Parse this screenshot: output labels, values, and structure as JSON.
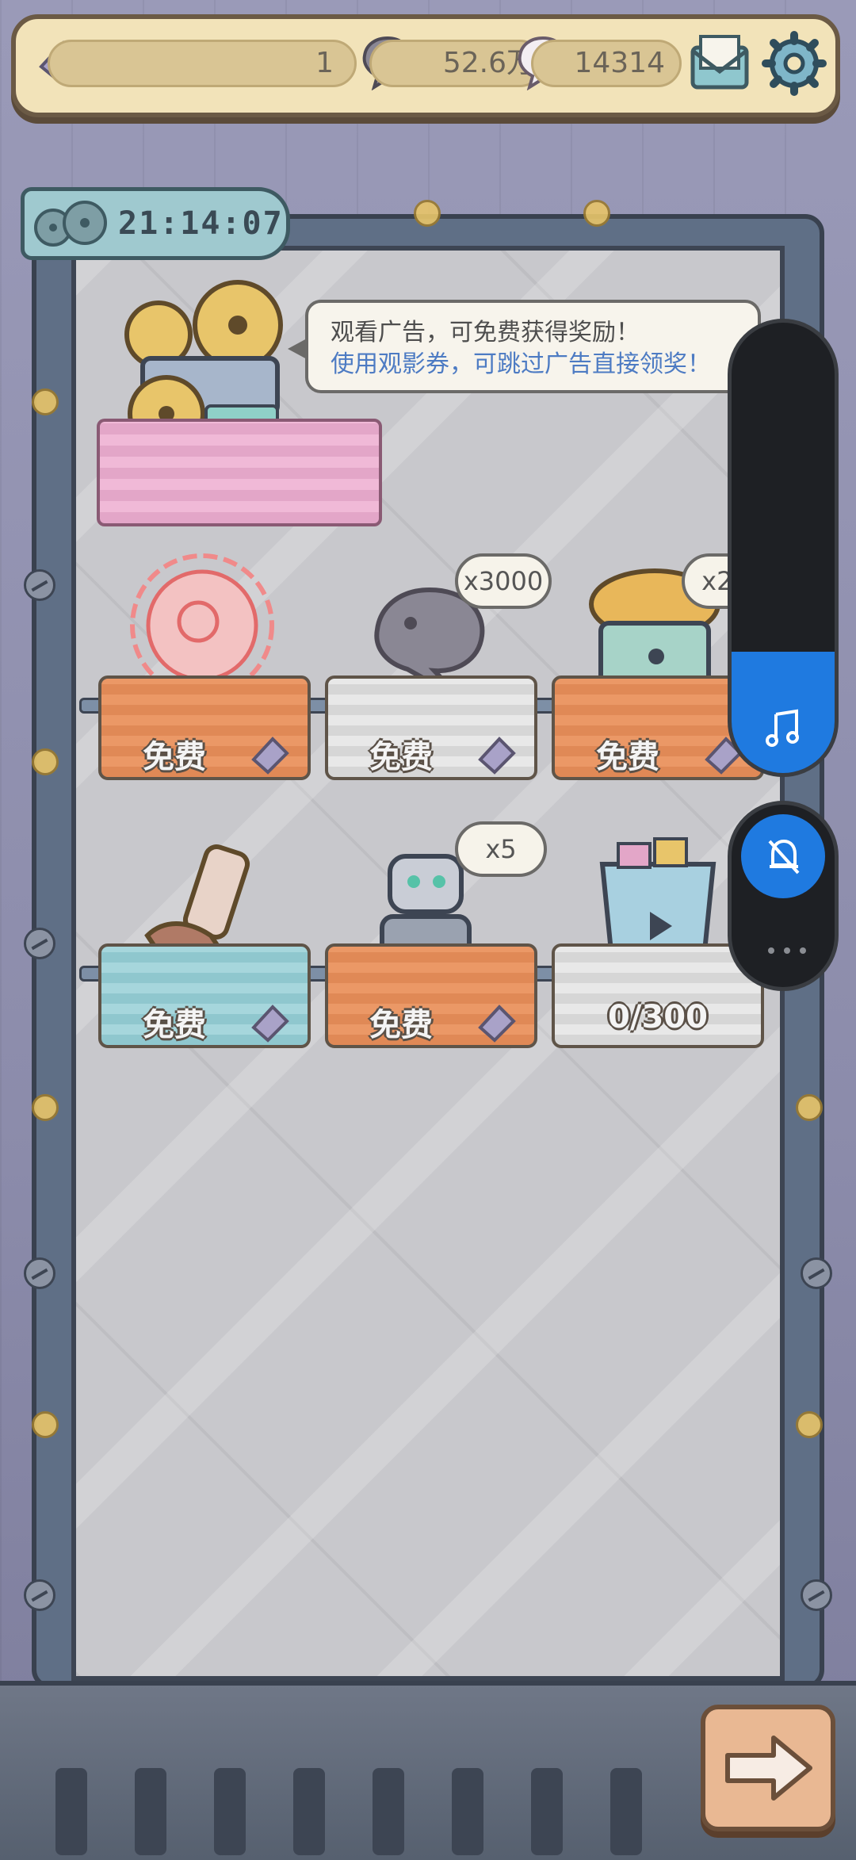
{
  "hud": {
    "tickets": "1",
    "coins": "52.6万",
    "gems": "14314",
    "icons": [
      "ticket-icon",
      "coin-bubble-icon",
      "gem-bubble-icon",
      "mail-icon",
      "gear-icon"
    ]
  },
  "timer": {
    "time": "21:14:07"
  },
  "promo": {
    "line1": "观看广告，可免费获得奖励！",
    "line2": "使用观影券，可跳过广告直接领奖！"
  },
  "rewards": [
    {
      "label": "免费",
      "color": "orange",
      "item": "red-orb"
    },
    {
      "label": "免费",
      "color": "white",
      "item": "gray-bubble",
      "qty": "x3000"
    },
    {
      "label": "免费",
      "color": "orange",
      "item": "mushroom-chest",
      "qty": "x20"
    },
    {
      "label": "免费",
      "color": "blue",
      "item": "boot"
    },
    {
      "label": "免费",
      "color": "orange",
      "item": "robot",
      "qty": "x5"
    },
    {
      "label": "0/300",
      "color": "white",
      "item": "ticket-bucket"
    }
  ],
  "system_overlay": {
    "volume_level_fraction": 0.27,
    "icons": [
      "music-note-icon",
      "bell-mute-icon",
      "more-icon"
    ],
    "accent": "#1f7ae0"
  },
  "colors": {
    "hud_bg": "#f2e3b9",
    "highlight_text": "#4d7bc3",
    "frame": "#5f6f86"
  }
}
